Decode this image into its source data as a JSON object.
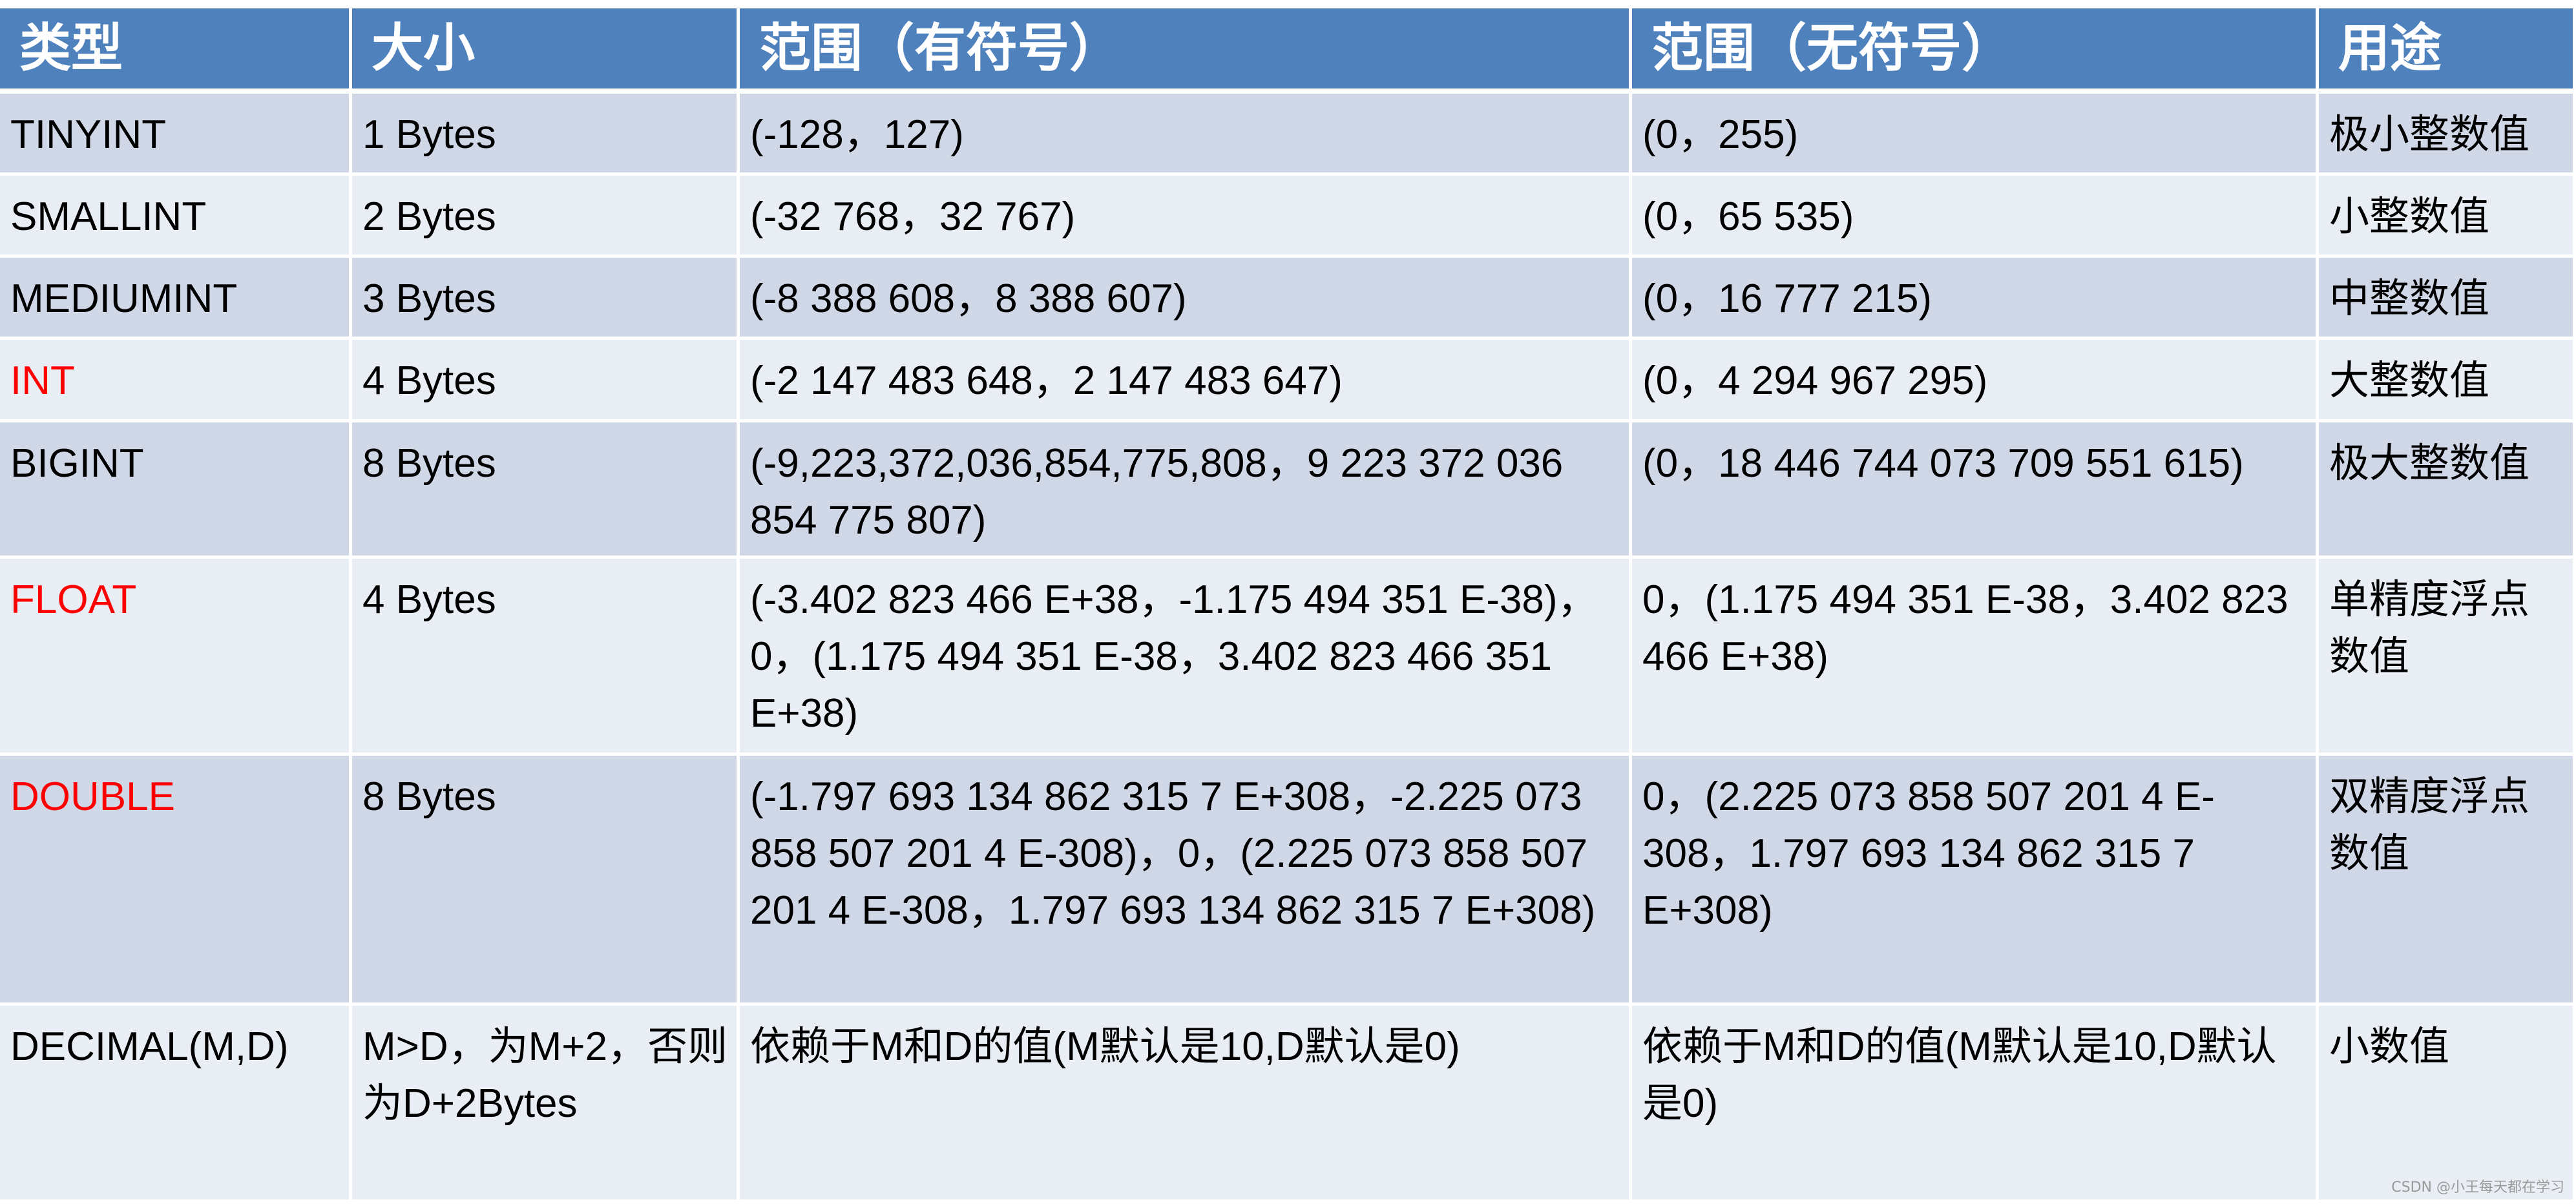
{
  "header": [
    "类型",
    "大小",
    "范围（有符号）",
    "范围（无符号）",
    "用途"
  ],
  "rows": [
    {
      "type": "TINYINT",
      "highlight": false,
      "size": "1 Bytes",
      "signed": "(-128，127)",
      "unsigned": "(0，255)",
      "usage": "极小整数值"
    },
    {
      "type": "SMALLINT",
      "highlight": false,
      "size": "2 Bytes",
      "signed": "(-32 768，32 767)",
      "unsigned": "(0，65 535)",
      "usage": "小整数值"
    },
    {
      "type": "MEDIUMINT",
      "highlight": false,
      "size": "3 Bytes",
      "signed": "(-8 388 608，8 388 607)",
      "unsigned": "(0，16 777 215)",
      "usage": "中整数值"
    },
    {
      "type": "INT",
      "highlight": true,
      "size": "4 Bytes",
      "signed": "(-2 147 483 648，2 147 483 647)",
      "unsigned": "(0，4 294 967 295)",
      "usage": "大整数值"
    },
    {
      "type": "BIGINT",
      "highlight": false,
      "size": "8 Bytes",
      "signed": "(-9,223,372,036,854,775,808，9 223 372 036 854 775 807)",
      "unsigned": "(0，18 446 744 073 709 551 615)",
      "usage": "极大整数值"
    },
    {
      "type": "FLOAT",
      "highlight": true,
      "size": "4 Bytes",
      "signed": "(-3.402 823 466 E+38，-1.175 494 351 E-38)，0，(1.175 494 351 E-38，3.402 823 466 351 E+38)",
      "unsigned": "0，(1.175 494 351 E-38，3.402 823 466 E+38)",
      "usage": "单精度浮点数值"
    },
    {
      "type": "DOUBLE",
      "highlight": true,
      "size": "8 Bytes",
      "signed": "(-1.797 693 134 862 315 7 E+308，-2.225 073 858 507 201 4 E-308)，0，(2.225 073 858 507 201 4 E-308，1.797 693 134 862 315 7 E+308)",
      "unsigned": "0，(2.225 073 858 507 201 4 E-308，1.797 693 134 862 315 7 E+308)",
      "usage": "双精度浮点数值"
    },
    {
      "type": "DECIMAL(M,D)",
      "highlight": false,
      "size": "M>D，为M+2，否则为D+2Bytes",
      "signed": "依赖于M和D的值(M默认是10,D默认是0)",
      "unsigned": "依赖于M和D的值(M默认是10,D默认是0)",
      "usage": "小数值"
    }
  ],
  "watermark": "CSDN @小王每天都在学习",
  "colors": {
    "header_bg": "#4F81BD",
    "row_odd": "#D0D8E8",
    "row_even": "#E9EDF4",
    "highlight_text": "#FF0000"
  }
}
